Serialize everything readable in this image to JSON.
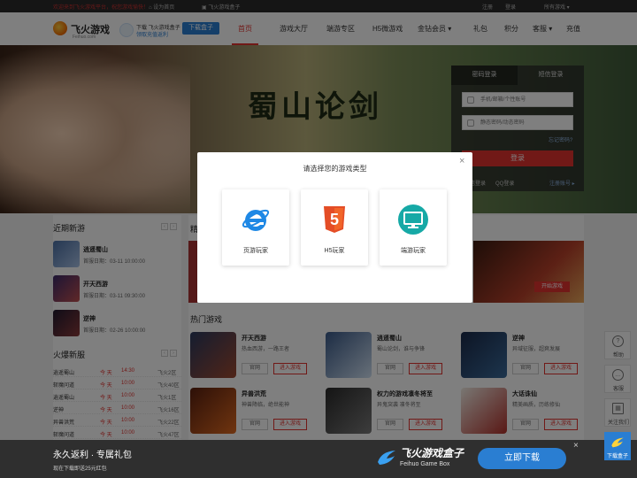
{
  "topbar": {
    "welcome": "欢迎来到飞火游戏平台，祝您游戏愉快！",
    "home": "设为首页",
    "save": "飞火游戏盒子",
    "register": "注册",
    "login": "登录",
    "all_games": "所有游戏 ▾"
  },
  "header": {
    "logo_title": "飞火游戏",
    "logo_sub": "Feihuo.com",
    "box_line1": "下载 飞火游戏盒子",
    "box_line2": "领取充值返利",
    "box_button": "下载盒子",
    "nav": [
      "首页",
      "游戏大厅",
      "端游专区",
      "H5微游戏",
      "金钻会员 ▾",
      "礼包",
      "积分",
      "客服 ▾",
      "充值"
    ]
  },
  "banner": {
    "title": "蜀山论剑"
  },
  "login": {
    "tab_password": "密码登录",
    "tab_sms": "短信登录",
    "account_placeholder": "手机/邮箱/个性账号",
    "password_placeholder": "静态密码/动态密码",
    "forgot": "忘记密码?",
    "submit": "登录",
    "wechat": "微信登录",
    "qq": "QQ登录",
    "register": "注册账号 ▸"
  },
  "recent": {
    "title": "近期新游",
    "games": [
      {
        "name": "逍遥蜀山",
        "date": "首服日期：03-11 10:00:00"
      },
      {
        "name": "开天西游",
        "date": "首服日期：03-11 09:30:00"
      },
      {
        "name": "逆神",
        "date": "首服日期：02-26 10:00:00"
      }
    ]
  },
  "hot_servers": {
    "title": "火爆新服",
    "rows": [
      {
        "game": "逍遥蜀山",
        "day": "今 天",
        "time": "14:30",
        "server": "飞火2区"
      },
      {
        "game": "斩魔问道",
        "day": "今 天",
        "time": "10:00",
        "server": "飞火40区"
      },
      {
        "game": "逍遥蜀山",
        "day": "今 天",
        "time": "10:00",
        "server": "飞火1区"
      },
      {
        "game": "逆神",
        "day": "今 天",
        "time": "10:00",
        "server": "飞火16区"
      },
      {
        "game": "异兽洪荒",
        "day": "今 天",
        "time": "10:00",
        "server": "飞火22区"
      },
      {
        "game": "斩魔问道",
        "day": "今 天",
        "time": "10:00",
        "server": "飞火47区"
      }
    ]
  },
  "featured": {
    "title": "精",
    "start_button": "开始游戏"
  },
  "hot_games": {
    "title": "热门游戏",
    "site_label": "官网",
    "enter_label": "进入游戏",
    "cards": [
      {
        "name": "开天西游",
        "desc": "热血西游，一路王者"
      },
      {
        "name": "逍遥蜀山",
        "desc": "蜀山论剑，谁与争锋"
      },
      {
        "name": "逆神",
        "desc": "异域征服，超爽发展"
      },
      {
        "name": "异兽洪荒",
        "desc": "神兽降临，绝世能神"
      },
      {
        "name": "权力的游戏凛冬将至",
        "desc": "异鬼突袭 凛冬将至"
      },
      {
        "name": "大话诛仙",
        "desc": "精美画质，历练修仙"
      }
    ]
  },
  "float_bar": {
    "help": "帮助",
    "service": "客服",
    "follow": "关注我们",
    "download": "下载盒子"
  },
  "modal": {
    "title": "请选择您的游戏类型",
    "close": "×",
    "options": [
      "页游玩家",
      "H5玩家",
      "端游玩家"
    ],
    "h5_text": "5"
  },
  "bottom_bar": {
    "line1": "永久返利 · 专属礼包",
    "line2": "现在下载即送25元红包",
    "brand": "飞火游戏盒子",
    "brand_sub": "Feihuo Game Box",
    "download": "立即下载",
    "close": "×"
  },
  "colors": {
    "accent": "#e3322f",
    "blue": "#2a7ed2",
    "teal": "#16a9a6"
  }
}
